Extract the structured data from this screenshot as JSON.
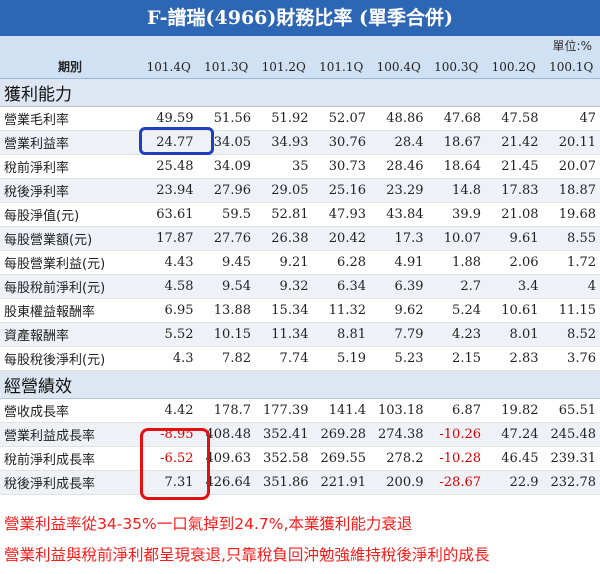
{
  "title": "F-譜瑞(4966)財務比率 (單季合併)",
  "unit": "單位:%",
  "header": {
    "label": "期別",
    "periods": [
      "101.4Q",
      "101.3Q",
      "101.2Q",
      "101.1Q",
      "100.4Q",
      "100.3Q",
      "100.2Q",
      "100.1Q"
    ]
  },
  "sections": [
    {
      "name": "獲利能力",
      "rows": [
        {
          "label": "營業毛利率",
          "values": [
            "49.59",
            "51.56",
            "51.92",
            "52.07",
            "48.86",
            "47.68",
            "47.58",
            "47"
          ]
        },
        {
          "label": "營業利益率",
          "values": [
            "24.77",
            "34.05",
            "34.93",
            "30.76",
            "28.4",
            "18.67",
            "21.42",
            "20.11"
          ]
        },
        {
          "label": "稅前淨利率",
          "values": [
            "25.48",
            "34.09",
            "35",
            "30.73",
            "28.46",
            "18.64",
            "21.45",
            "20.07"
          ]
        },
        {
          "label": "稅後淨利率",
          "values": [
            "23.94",
            "27.96",
            "29.05",
            "25.16",
            "23.29",
            "14.8",
            "17.83",
            "18.87"
          ]
        },
        {
          "label": "每股淨值(元)",
          "values": [
            "63.61",
            "59.5",
            "52.81",
            "47.93",
            "43.84",
            "39.9",
            "21.08",
            "19.68"
          ]
        },
        {
          "label": "每股營業額(元)",
          "values": [
            "17.87",
            "27.76",
            "26.38",
            "20.42",
            "17.3",
            "10.07",
            "9.61",
            "8.55"
          ]
        },
        {
          "label": "每股營業利益(元)",
          "values": [
            "4.43",
            "9.45",
            "9.21",
            "6.28",
            "4.91",
            "1.88",
            "2.06",
            "1.72"
          ]
        },
        {
          "label": "每股稅前淨利(元)",
          "values": [
            "4.58",
            "9.54",
            "9.32",
            "6.34",
            "6.39",
            "2.7",
            "3.4",
            "4"
          ]
        },
        {
          "label": "股東權益報酬率",
          "values": [
            "6.95",
            "13.88",
            "15.34",
            "11.32",
            "9.62",
            "5.24",
            "10.61",
            "11.15"
          ]
        },
        {
          "label": "資產報酬率",
          "values": [
            "5.52",
            "10.15",
            "11.34",
            "8.81",
            "7.79",
            "4.23",
            "8.01",
            "8.52"
          ]
        },
        {
          "label": "每股稅後淨利(元)",
          "values": [
            "4.3",
            "7.82",
            "7.74",
            "5.19",
            "5.23",
            "2.15",
            "2.83",
            "3.76"
          ]
        }
      ]
    },
    {
      "name": "經營績效",
      "rows": [
        {
          "label": "營收成長率",
          "values": [
            "4.42",
            "178.7",
            "177.39",
            "141.4",
            "103.18",
            "6.87",
            "19.82",
            "65.51"
          ]
        },
        {
          "label": "營業利益成長率",
          "values": [
            "-8.95",
            "408.48",
            "352.41",
            "269.28",
            "274.38",
            "-10.26",
            "47.24",
            "245.48"
          ]
        },
        {
          "label": "稅前淨利成長率",
          "values": [
            "-6.52",
            "409.63",
            "352.58",
            "269.55",
            "278.2",
            "-10.28",
            "46.45",
            "239.31"
          ]
        },
        {
          "label": "稅後淨利成長率",
          "values": [
            "7.31",
            "426.64",
            "351.86",
            "221.91",
            "200.9",
            "-28.67",
            "22.9",
            "232.78"
          ]
        }
      ]
    }
  ],
  "annotations": {
    "note1": "營業利益率從34-35%一口氣掉到24.7%,本業獲利能力衰退",
    "note2": "營業利益與稅前淨利都呈現衰退,只靠稅負回沖勉強維持稅後淨利的成長",
    "blue_color": "#1f3fbf",
    "red_color": "#e31010"
  }
}
